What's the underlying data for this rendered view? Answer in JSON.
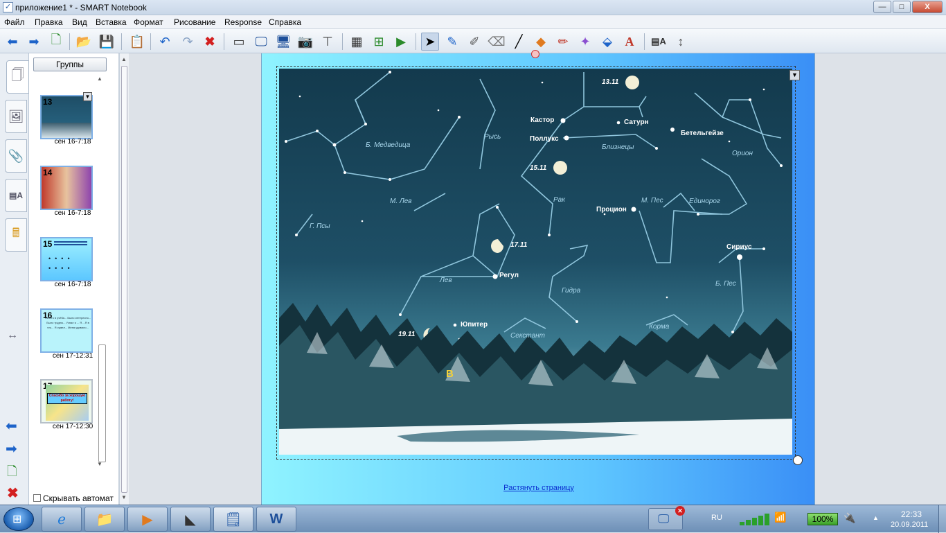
{
  "window": {
    "title": "приложение1 * - SMART Notebook",
    "min": "—",
    "max": "□",
    "close": "X"
  },
  "menu": [
    "Файл",
    "Правка",
    "Вид",
    "Вставка",
    "Формат",
    "Рисование",
    "Response",
    "Справка"
  ],
  "sorter": {
    "groups_label": "Группы",
    "thumbs": [
      {
        "num": "13",
        "caption": "сен 16-7:18"
      },
      {
        "num": "14",
        "caption": "сен 16-7:18"
      },
      {
        "num": "15",
        "caption": "сен 16-7:18"
      },
      {
        "num": "16",
        "caption": "сен 17-12:31",
        "text": "Ничего в учёба... Было интересно... Было трудно... Узнал я ... Я ...Я в что... Я сумел... Меня удивило..."
      },
      {
        "num": "17",
        "caption": "сен 17-12:30",
        "text": "Спасибо за хорошую работу!"
      }
    ],
    "autohide_label": "Скрывать автомат"
  },
  "page": {
    "stretch_link": "Растянуть страницу"
  },
  "sky": {
    "labels": {
      "ursa_major": "Б. Медведица",
      "lynx": "Рысь",
      "leo_minor": "М. Лев",
      "canes": "Г. Псы",
      "leo": "Лев",
      "regulus": "Регул",
      "d1711": "17.11",
      "d1511": "15.11",
      "d1311": "13.11",
      "d1911": "19.11",
      "jupiter": "Юпитер",
      "sextant": "Секстант",
      "hydra": "Гидра",
      "cancer": "Рак",
      "procyon": "Процион",
      "canis_minor": "М. Пес",
      "monoceros": "Единорог",
      "castor": "Кастор",
      "pollux": "Поллукс",
      "saturn": "Сатурн",
      "gemini": "Близнецы",
      "betelgeuse": "Бетельгейзе",
      "orion": "Орион",
      "sirius": "Сириус",
      "canis_major": "Б. Пес",
      "puppis": "Корма",
      "marker": "В"
    }
  },
  "taskbar": {
    "lang": "RU",
    "battery": "100%",
    "time": "22:33",
    "date": "20.09.2011"
  }
}
